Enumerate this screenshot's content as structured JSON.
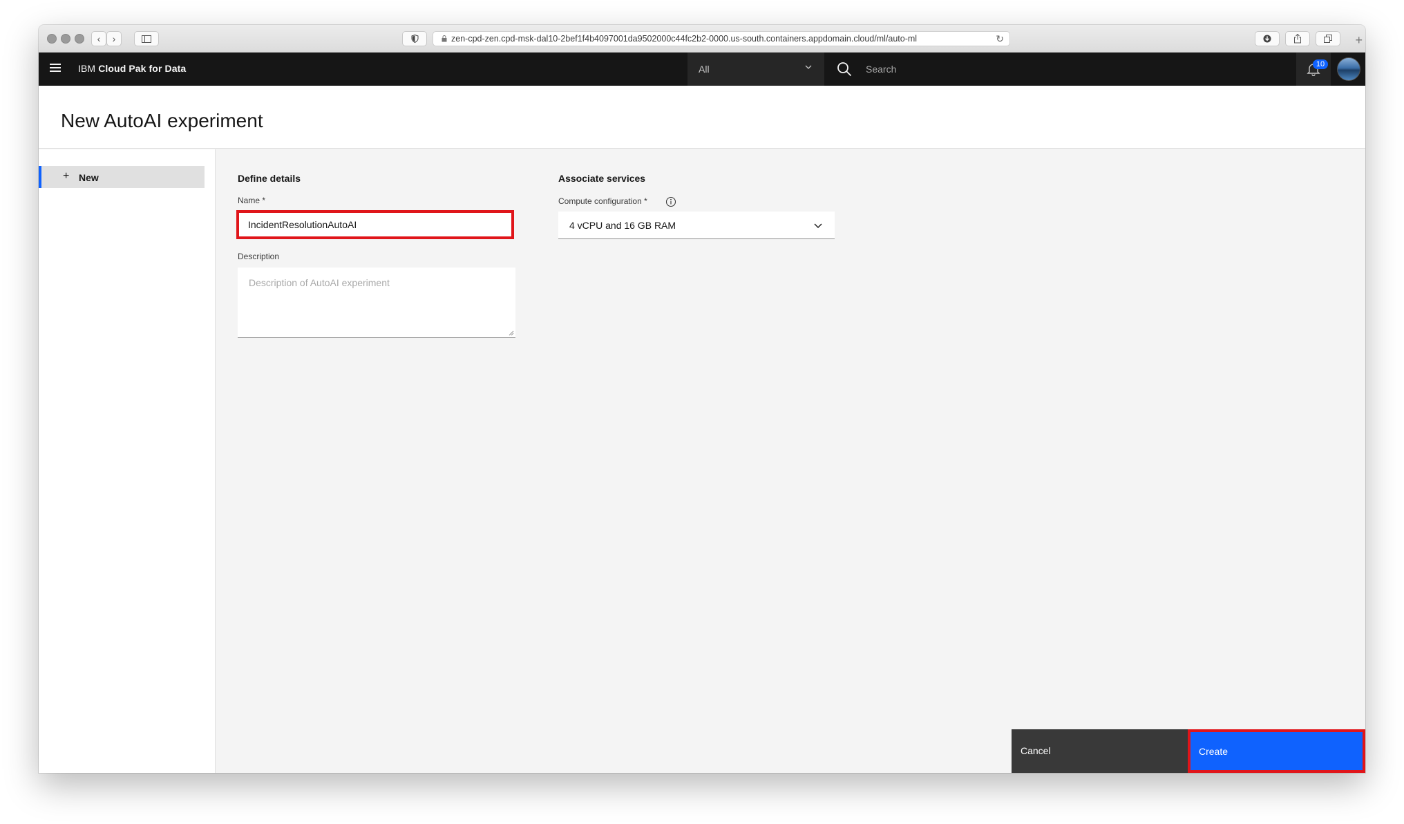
{
  "browser": {
    "url": "zen-cpd-zen.cpd-msk-dal10-2bef1f4b4097001da9502000c44fc2b2-0000.us-south.containers.appdomain.cloud/ml/auto-ml"
  },
  "header": {
    "brand_prefix": "IBM",
    "brand_name": "Cloud Pak for Data",
    "scope_value": "All",
    "search_placeholder": "Search",
    "notification_count": "10"
  },
  "page": {
    "title": "New AutoAI experiment"
  },
  "leftnav": {
    "items": [
      {
        "label": "New",
        "icon": "plus-icon"
      }
    ]
  },
  "define_details": {
    "title": "Define details",
    "name_label": "Name *",
    "name_value": "IncidentResolutionAutoAI",
    "description_label": "Description",
    "description_placeholder": "Description of AutoAI experiment"
  },
  "associate_services": {
    "title": "Associate services",
    "compute_label": "Compute configuration *",
    "compute_value": "4 vCPU and 16 GB RAM"
  },
  "footer": {
    "cancel_label": "Cancel",
    "create_label": "Create"
  },
  "colors": {
    "header_bg": "#161616",
    "primary_blue": "#0f62fe",
    "highlight_red": "#e0151a",
    "secondary_button": "#393939"
  }
}
